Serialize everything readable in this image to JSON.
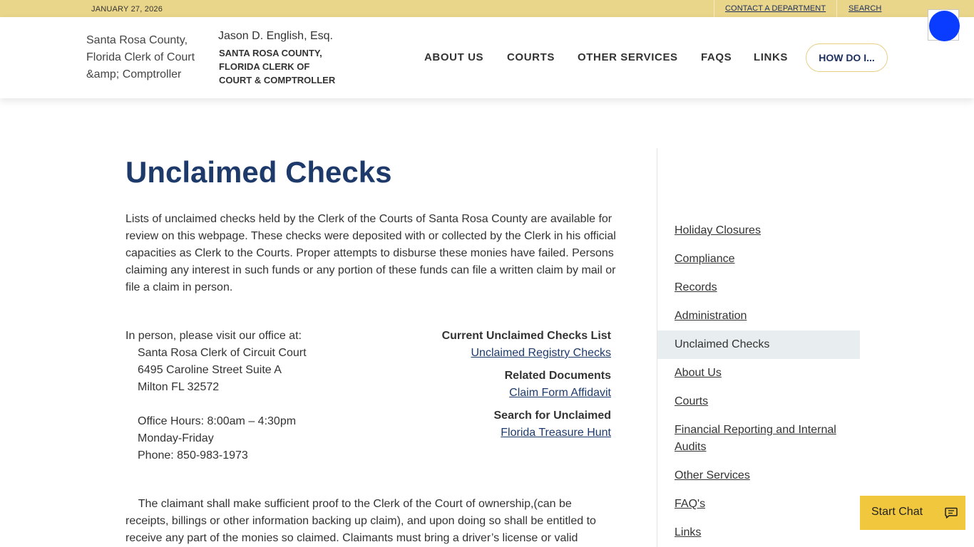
{
  "topbar": {
    "date": "JANUARY 27, 2026",
    "contact_link": "CONTACT A DEPARTMENT",
    "search_link": "SEARCH"
  },
  "header": {
    "logo_alt": "Santa Rosa County, Florida Clerk of Court &amp; Comptroller",
    "clerk_name": "Jason D. English, Esq.",
    "clerk_office": "SANTA ROSA COUNTY, FLORIDA CLERK OF COURT & COMPTROLLER",
    "nav": [
      "ABOUT US",
      "COURTS",
      "OTHER SERVICES",
      "FAQS",
      "LINKS"
    ],
    "how_do_i": "HOW DO I..."
  },
  "main": {
    "title": "Unclaimed Checks",
    "intro": "Lists of unclaimed checks held by the Clerk of the Courts of Santa Rosa County are available for review on this webpage. These checks were deposited with or collected by the Clerk in his official capacities as Clerk to the Courts. Proper attempts to disburse these monies have failed. Persons claiming any interest in such funds or any portion of these funds can file a written claim by mail or file a claim in person.",
    "in_person_label": "In person, please visit our office at:",
    "office_name": "Santa Rosa Clerk of Circuit Court",
    "address_line1": "6495 Caroline Street Suite A",
    "address_line2": "Milton FL 32572",
    "hours": "Office Hours: 8:00am – 4:30pm",
    "days": "Monday-Friday",
    "phone": "Phone: 850-983-1973",
    "resources": [
      {
        "heading": "Current Unclaimed Checks List",
        "link": "Unclaimed Registry Checks"
      },
      {
        "heading": "Related Documents",
        "link": "Claim Form Affidavit"
      },
      {
        "heading": "Search for Unclaimed",
        "link": "Florida Treasure Hunt"
      }
    ],
    "claimant_text": "The claimant shall make sufficient proof to the Clerk of the Court of ownership,(can be receipts, billings or other information backing up claim), and upon doing so shall be entitled to receive any part of the monies so claimed. Claimants must bring a driver’s license or valid"
  },
  "sidebar": {
    "items": [
      {
        "label": "Holiday Closures"
      },
      {
        "label": "Compliance "
      },
      {
        "label": "Records"
      },
      {
        "label": "Administration "
      },
      {
        "label": "Unclaimed Checks",
        "active": true
      },
      {
        "label": "About Us"
      },
      {
        "label": "Courts"
      },
      {
        "label": "Financial Reporting and Internal Audits"
      },
      {
        "label": "Other Services"
      },
      {
        "label": "FAQ's"
      },
      {
        "label": "Links"
      }
    ]
  },
  "chat": {
    "label": "Start Chat",
    "icon": "chat-bubble-icon"
  },
  "colors": {
    "topbar": "#ead68a",
    "title": "#1d3a6b",
    "chat": "#f0c73d",
    "active_sidebar": "#e8eeef",
    "accessibility": "#0a3cff"
  }
}
